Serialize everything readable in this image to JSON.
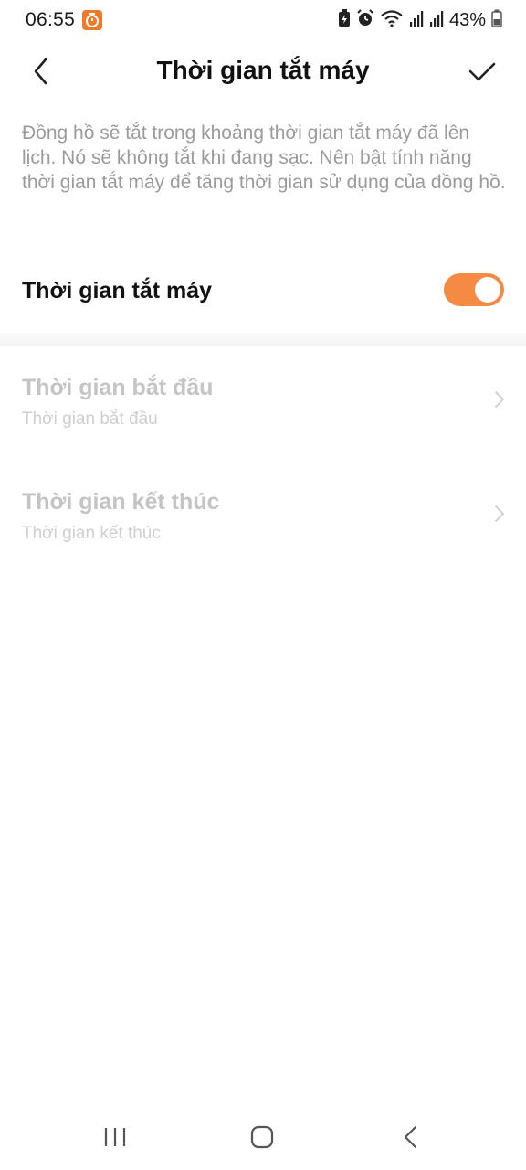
{
  "status_bar": {
    "time": "06:55",
    "battery": "43%",
    "icons": [
      "app-notification-icon",
      "battery-saver-icon",
      "alarm-icon",
      "wifi-icon",
      "signal-icon",
      "signal-icon",
      "battery-icon"
    ]
  },
  "header": {
    "title": "Thời gian tắt máy",
    "back_icon": "chevron-left-icon",
    "confirm_icon": "checkmark-icon"
  },
  "description": "Đồng hồ sẽ tắt trong khoảng thời gian tắt máy đã lên lịch. Nó sẽ không tắt khi đang sạc. Nên bật tính năng thời gian tắt máy để tăng thời gian sử dụng của đồng hồ.",
  "toggle": {
    "label": "Thời gian tắt máy",
    "on": true
  },
  "rows": [
    {
      "title": "Thời gian bắt đầu",
      "subtitle": "Thời gian bắt đầu"
    },
    {
      "title": "Thời gian kết thúc",
      "subtitle": "Thời gian kết thúc"
    }
  ],
  "nav_bar": {
    "icons": [
      "recent-apps-icon",
      "home-icon",
      "back-icon"
    ]
  },
  "colors": {
    "accent": "#f58a42",
    "disabled_text": "#c4c4c4",
    "description_text": "#9b9b9b"
  }
}
